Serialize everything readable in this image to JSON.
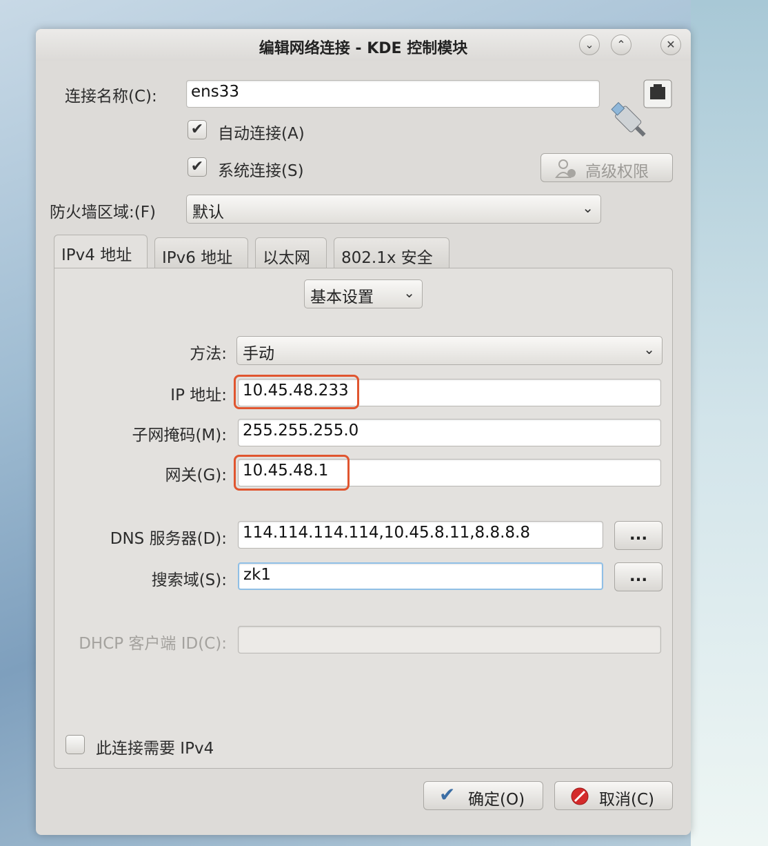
{
  "window": {
    "title": "编辑网络连接 - KDE 控制模块",
    "minimize_glyph": "⌄",
    "maximize_glyph": "⌃",
    "close_glyph": "✕"
  },
  "connection": {
    "name_label": "连接名称(C):",
    "name_value": "ens33",
    "auto_connect_label": "自动连接(A)",
    "auto_connect_checked": true,
    "system_connect_label": "系统连接(S)",
    "system_connect_checked": true,
    "advanced_permissions_label": "高级权限",
    "firewall_label": "防火墙区域:(F)",
    "firewall_value": "默认"
  },
  "tabs": [
    {
      "label": "IPv4 地址",
      "active": true
    },
    {
      "label": "IPv6 地址",
      "active": false
    },
    {
      "label": "以太网",
      "active": false
    },
    {
      "label": "802.1x 安全",
      "active": false
    }
  ],
  "ipv4": {
    "mode_value": "基本设置",
    "method_label": "方法:",
    "method_value": "手动",
    "ip_label": "IP 地址:",
    "ip_value": "10.45.48.233",
    "netmask_label": "子网掩码(M):",
    "netmask_value": "255.255.255.0",
    "gateway_label": "网关(G):",
    "gateway_value": "10.45.48.1",
    "dns_label": "DNS 服务器(D):",
    "dns_value": "114.114.114.114,10.45.8.11,8.8.8.8",
    "search_label": "搜索域(S):",
    "search_value": "zk1",
    "dhcp_label": "DHCP 客户端 ID(C):",
    "dhcp_value": "",
    "more_button": "...",
    "require_label": "此连接需要 IPv4",
    "require_checked": false
  },
  "footer": {
    "ok_label": "确定(O)",
    "cancel_label": "取消(C)"
  },
  "colors": {
    "highlight": "#e0552f",
    "focus": "#8fbfe6"
  },
  "icons": {
    "check": "✔",
    "chevron": "⌄"
  }
}
